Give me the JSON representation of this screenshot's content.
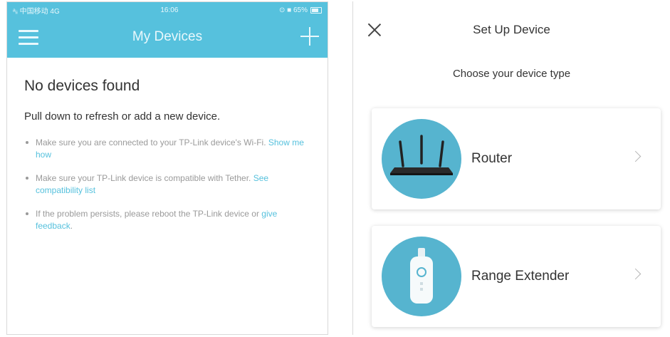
{
  "left_screen": {
    "status_bar": {
      "carrier": "ᵃᵢᵢ 中国移动 4G",
      "time": "16:06",
      "battery": "⊙ ■ 65%"
    },
    "nav": {
      "title": "My Devices"
    },
    "empty_state": {
      "heading": "No devices found",
      "subheading": "Pull down to refresh or add a new device.",
      "tips": [
        {
          "text": "Make sure you are connected to your TP-Link device's Wi-Fi. ",
          "link": "Show me how"
        },
        {
          "text": "Make sure your TP-Link device is compatible with Tether. ",
          "link": "See compatibility list"
        },
        {
          "text": "If the problem persists, please reboot the TP-Link device or ",
          "link": "give feedback",
          "suffix": "."
        }
      ]
    }
  },
  "right_screen": {
    "title": "Set Up Device",
    "prompt": "Choose your device type",
    "device_types": [
      {
        "label": "Router",
        "icon": "router-icon"
      },
      {
        "label": "Range Extender",
        "icon": "range-extender-icon"
      }
    ]
  },
  "colors": {
    "accent": "#56c1dd",
    "circle": "#56b4cf",
    "text": "#333333",
    "muted": "#9a9a9a"
  }
}
